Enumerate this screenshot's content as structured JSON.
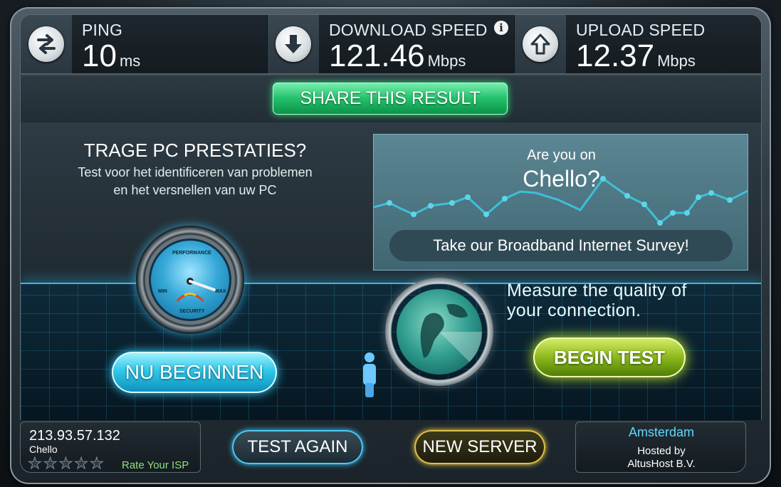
{
  "metrics": {
    "ping": {
      "label": "PING",
      "value": "10",
      "unit": "ms",
      "icon": "swap-arrows-icon"
    },
    "download": {
      "label": "DOWNLOAD SPEED",
      "value": "121.46",
      "unit": "Mbps",
      "icon": "arrow-down-icon",
      "info": "i"
    },
    "upload": {
      "label": "UPLOAD SPEED",
      "value": "12.37",
      "unit": "Mbps",
      "icon": "arrow-up-icon"
    }
  },
  "share": {
    "label": "SHARE THIS RESULT"
  },
  "promo": {
    "title": "TRAGE PC PRESTATIES?",
    "subtitle_line1": "Test voor het identificeren van problemen",
    "subtitle_line2": "en het versnellen van uw PC",
    "button_label": "NU BEGINNEN",
    "gauge": {
      "top": "PERFORMANCE",
      "min": "MIN",
      "max": "MAX",
      "bottom": "SECURITY"
    }
  },
  "survey": {
    "question": "Are you on",
    "isp": "Chello?",
    "button_label": "Take our Broadband Internet Survey!"
  },
  "measure": {
    "line1": "Measure the quality of",
    "line2": "your connection.",
    "button_label": "BEGIN TEST"
  },
  "isp_info": {
    "ip": "213.93.57.132",
    "isp": "Chello",
    "rating_stars": 5,
    "rating_value": 0,
    "rate_label": "Rate Your ISP"
  },
  "actions": {
    "test_again": "TEST AGAIN",
    "new_server": "NEW SERVER"
  },
  "server": {
    "city": "Amsterdam",
    "hosted_label": "Hosted by",
    "host": "AltusHost B.V."
  },
  "colors": {
    "share_green": "#22c06a",
    "nu_cyan": "#31c8ea",
    "begin_lime": "#8cb81c",
    "server_city": "#5fd8ff",
    "rate_green": "#8fe07c"
  }
}
